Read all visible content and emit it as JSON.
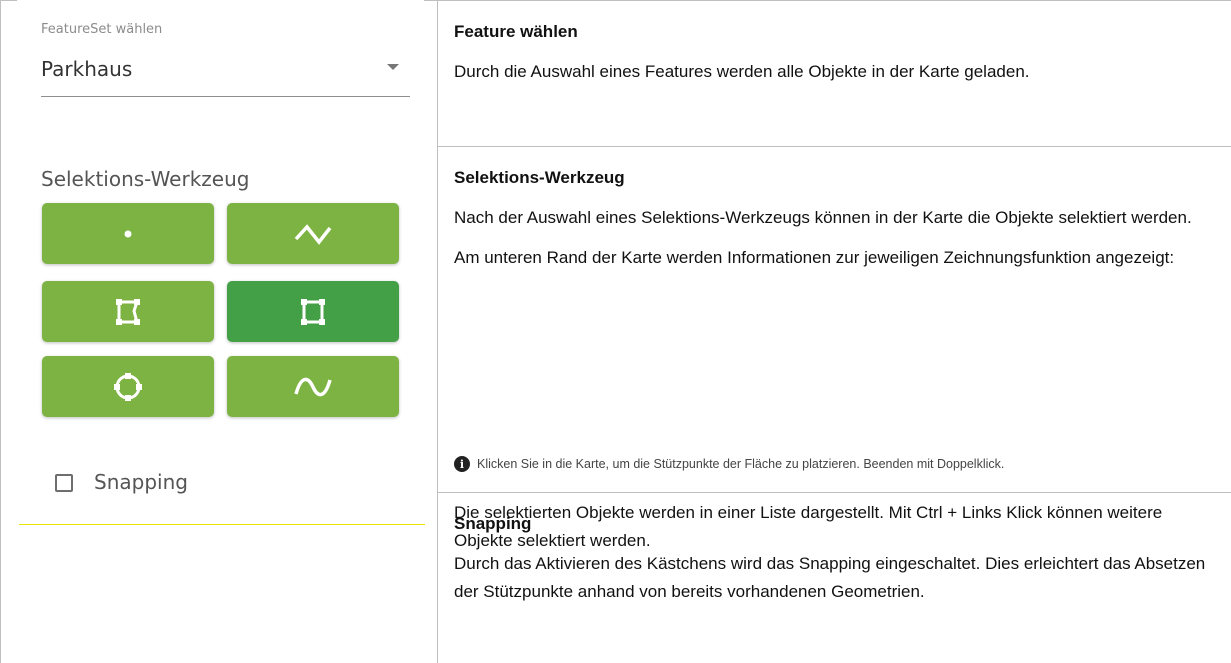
{
  "left": {
    "featureset_label": "FeatureSet wählen",
    "featureset_value": "Parkhaus",
    "tools_label": "Selektions-Werkzeug",
    "tools": [
      {
        "name": "point-tool",
        "icon": "point-icon",
        "active": false
      },
      {
        "name": "polyline-tool",
        "icon": "polyline-icon",
        "active": false
      },
      {
        "name": "polygon-tool",
        "icon": "polygon-icon",
        "active": false
      },
      {
        "name": "rectangle-tool",
        "icon": "rectangle-icon",
        "active": true
      },
      {
        "name": "circle-tool",
        "icon": "circle-icon",
        "active": false
      },
      {
        "name": "freehand-tool",
        "icon": "freehand-icon",
        "active": false
      }
    ],
    "snapping_label": "Snapping",
    "colors": {
      "button": "#7cb342",
      "button_active": "#43a047"
    }
  },
  "rows": [
    {
      "title": "Feature wählen",
      "text": "Durch die Auswahl eines Features werden alle Objekte in der Karte geladen."
    },
    {
      "title": "Selektions-Werkzeug",
      "text1": "Nach der Auswahl eines Selektions-Werkzeugs können in der Karte die Objekte selektiert werden.",
      "text2": "Am unteren Rand der Karte werden Informationen zur jeweiligen Zeichnungsfunktion angezeigt:",
      "note": "Klicken Sie in die Karte, um die Stützpunkte der Fläche zu platzieren. Beenden mit Doppelklick.",
      "text3": "Die selektierten Objekte werden in einer Liste dargestellt. Mit Ctrl + Links Klick können weitere Objekte selektiert werden."
    },
    {
      "title": "Snapping",
      "text": "Durch das Aktivieren des Kästchens wird das Snapping eingeschaltet. Dies erleichtert das Absetzen der Stützpunkte anhand von bereits vorhandenen Geometrien."
    }
  ]
}
